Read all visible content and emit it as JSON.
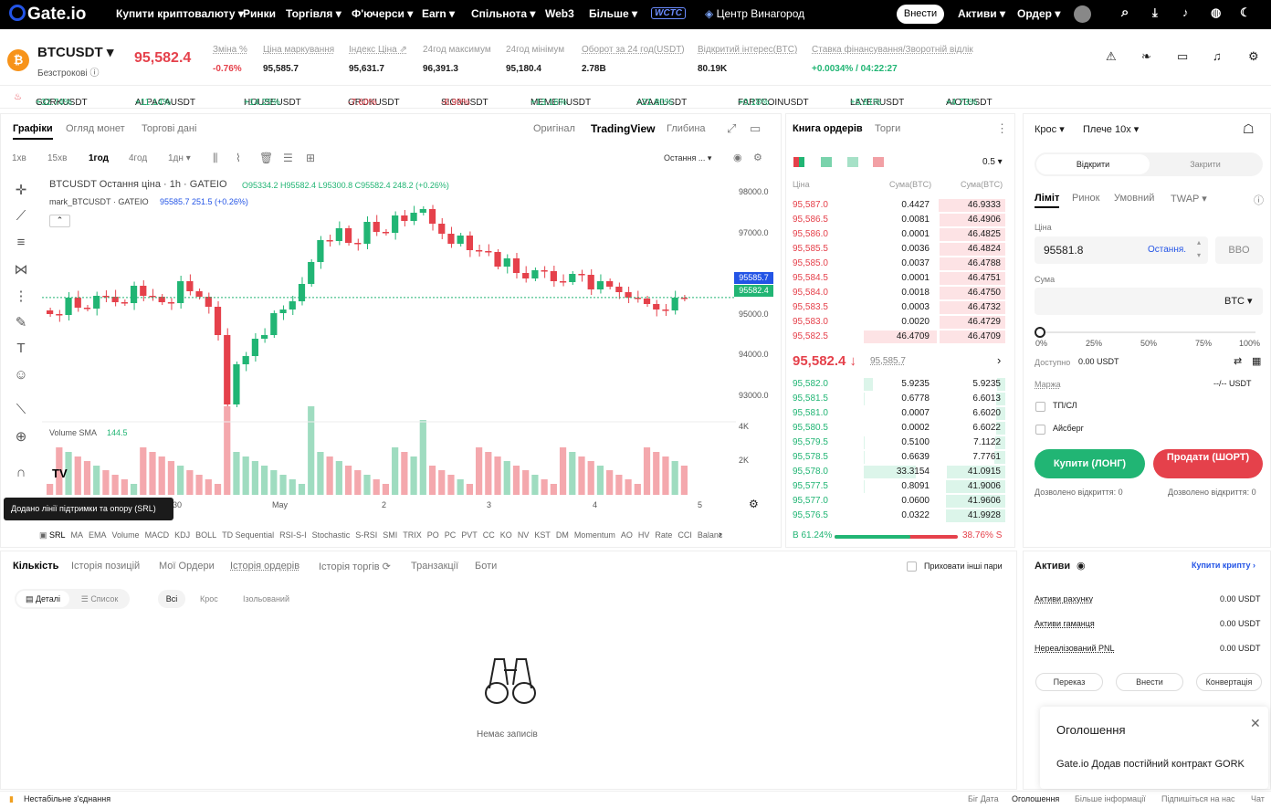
{
  "nav": {
    "logo": "Gate.io",
    "items": [
      "Купити криптовалюту ▾",
      "Ринки",
      "Торгівля ▾",
      "Ф'ючерси ▾",
      "Earn ▾",
      "Спільнота ▾",
      "Web3",
      "Більше ▾"
    ],
    "wctc": "WCTC",
    "vineyard": "Центр Винагород",
    "deposit": "Внести",
    "assets": "Активи ▾",
    "orders": "Ордер ▾"
  },
  "header": {
    "pair": "BTCUSDT ▾",
    "sub": "Безстрокові ⓘ",
    "price": "95,582.4",
    "stats": [
      {
        "l": "Зміна %",
        "v": "-0.76%"
      },
      {
        "l": "Ціна маркування",
        "v": "95,585.7"
      },
      {
        "l": "Індекс Ціна ⇗",
        "v": "95,631.7"
      },
      {
        "l": "24год максимум",
        "v": "96,391.3"
      },
      {
        "l": "24год мінімум",
        "v": "95,180.4"
      },
      {
        "l": "Оборот за 24 год(USDT)",
        "v": "2.78B"
      },
      {
        "l": "Відкритий інтерес(BTC)",
        "v": "80.19K"
      },
      {
        "l": "Ставка фінансування/Зворотній відлік",
        "v": "+0.0034% / 04:22:27"
      }
    ]
  },
  "ticker": [
    {
      "s": "GORKUSDT",
      "c": "+32.74%"
    },
    {
      "s": "ALPACAUSDT",
      "c": "+11.14%"
    },
    {
      "s": "HOUSEUSDT",
      "c": "+14.25%"
    },
    {
      "s": "GROKUSDT",
      "c": "-7.60%"
    },
    {
      "s": "SIGNUSDT",
      "c": "-6.99%"
    },
    {
      "s": "MEMEFIUSDT",
      "c": "+13.16%"
    },
    {
      "s": "AVAAIUSDT",
      "c": "+21.80%"
    },
    {
      "s": "FARTCOINUSDT",
      "c": "+0.18%"
    },
    {
      "s": "LAYERUSDT",
      "c": "+5.81%"
    },
    {
      "s": "AIOTUSDT",
      "c": "+4.73%"
    }
  ],
  "chart": {
    "tabs": [
      "Графіки",
      "Огляд монет",
      "Торгові дані"
    ],
    "views": [
      "Оригінал",
      "TradingView",
      "Глибина"
    ],
    "intervals": [
      "1хв",
      "15хв",
      "1год",
      "4год",
      "1дн ▾"
    ],
    "last": "Остання ... ▾",
    "title": "BTCUSDT Остання ціна · 1h · GATEIO",
    "ohlc": "O95334.2 H95582.4 L95300.8 C95582.4 248.2 (+0.26%)",
    "mark": "mark_BTCUSDT · GATEIO",
    "markv": "95585.7  251.5 (+0.26%)",
    "yticks": [
      "98000.0",
      "97000.0",
      "96000.0",
      "95000.0",
      "94000.0",
      "93000.0"
    ],
    "tag1": "95585.7",
    "tag2": "95582.4",
    "vol": "Volume SMA",
    "volv": "144.5",
    "vticks": [
      "4K",
      "2K"
    ],
    "xticks": [
      "30",
      "May",
      "2",
      "3",
      "4",
      "5"
    ],
    "tooltip": "Додано лінії підтримки та опору (SRL)",
    "indicators": [
      "SRL",
      "MA",
      "EMA",
      "Volume",
      "MACD",
      "KDJ",
      "BOLL",
      "TD Sequential",
      "RSI-S-I",
      "Stochastic",
      "S-RSI",
      "SMI",
      "TRIX",
      "PO",
      "PC",
      "PVT",
      "CC",
      "KO",
      "NV",
      "KST",
      "DM",
      "Momentum",
      "AO",
      "HV",
      "Rate",
      "CCI",
      "Balanc"
    ]
  },
  "orderbook": {
    "tabs": [
      "Книга ордерів",
      "Торги"
    ],
    "step": "0.5 ▾",
    "h": [
      "Ціна",
      "Сума(BTC)",
      "Сума(BTC)"
    ],
    "asks": [
      [
        "95,587.0",
        "0.4427",
        "46.9333"
      ],
      [
        "95,586.5",
        "0.0081",
        "46.4906"
      ],
      [
        "95,586.0",
        "0.0001",
        "46.4825"
      ],
      [
        "95,585.5",
        "0.0036",
        "46.4824"
      ],
      [
        "95,585.0",
        "0.0037",
        "46.4788"
      ],
      [
        "95,584.5",
        "0.0001",
        "46.4751"
      ],
      [
        "95,584.0",
        "0.0018",
        "46.4750"
      ],
      [
        "95,583.5",
        "0.0003",
        "46.4732"
      ],
      [
        "95,583.0",
        "0.0020",
        "46.4729"
      ],
      [
        "95,582.5",
        "46.4709",
        "46.4709"
      ]
    ],
    "mid": "95,582.4 ↓",
    "midmark": "95,585.7",
    "bids": [
      [
        "95,582.0",
        "5.9235",
        "5.9235"
      ],
      [
        "95,581.5",
        "0.6778",
        "6.6013"
      ],
      [
        "95,581.0",
        "0.0007",
        "6.6020"
      ],
      [
        "95,580.5",
        "0.0002",
        "6.6022"
      ],
      [
        "95,579.5",
        "0.5100",
        "7.1122"
      ],
      [
        "95,578.5",
        "0.6639",
        "7.7761"
      ],
      [
        "95,578.0",
        "33.3154",
        "41.0915"
      ],
      [
        "95,577.5",
        "0.8091",
        "41.9006"
      ],
      [
        "95,577.0",
        "0.0600",
        "41.9606"
      ],
      [
        "95,576.5",
        "0.0322",
        "41.9928"
      ]
    ],
    "buypct": "B 61.24%",
    "sellpct": "38.76% S"
  },
  "order": {
    "mode": "Крос ▾",
    "lev": "Плече 10x ▾",
    "open": "Відкрити",
    "close": "Закрити",
    "types": [
      "Ліміт",
      "Ринок",
      "Умовний",
      "TWAP ▾"
    ],
    "price_l": "Ціна",
    "price": "95581.8",
    "last": "Остання.",
    "bbo": "BBO",
    "amt_l": "Сума",
    "unit": "BTC ▾",
    "pcts": [
      "0%",
      "25%",
      "50%",
      "75%",
      "100%"
    ],
    "avail_l": "Доступно",
    "avail": "0.00 USDT",
    "margin_l": "Маржа",
    "margin": "--/--  USDT",
    "tpsl": "ТП/СЛ",
    "iceberg": "Айсберг",
    "buy": "Купити (ЛОНГ)",
    "sell": "Продати (ШОРТ)",
    "can": "Дозволено відкриття:",
    "cv": "0"
  },
  "bottom": {
    "tabs": [
      "Кількість",
      "Історія позицій",
      "Мої Ордери",
      "Історія ордерів",
      "Історія торгів ⟳",
      "Транзакції",
      "Боти"
    ],
    "hide": "Приховати інші пари",
    "details": "Деталі",
    "list": "Список",
    "filters": [
      "Всі",
      "Крос",
      "Ізольований"
    ],
    "empty": "Немає записів"
  },
  "assets": {
    "title": "Активи",
    "buy": "Купити крипту ›",
    "rows": [
      [
        "Активи рахунку",
        "0.00 USDT"
      ],
      [
        "Активи гаманця",
        "0.00 USDT"
      ],
      [
        "Нереалізований PNL",
        "0.00 USDT"
      ]
    ],
    "btns": [
      "Переказ",
      "Внести",
      "Конвертація"
    ]
  },
  "notice": {
    "title": "Оголошення",
    "text": "Gate.io Додав постійний контракт GORK"
  },
  "status": {
    "conn": "Нестабільне з'єднання",
    "links": [
      "Біг Дата",
      "Оголошення",
      "Більше інформації",
      "Підпишіться на нас",
      "Чат"
    ]
  }
}
